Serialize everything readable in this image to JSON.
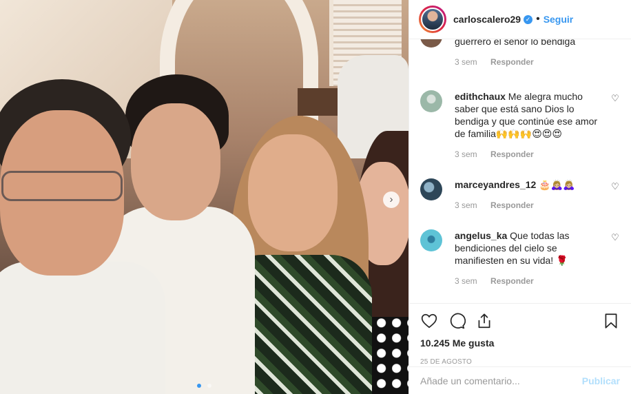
{
  "post": {
    "username": "carloscalero29",
    "separator": "•",
    "follow_label": "Seguir",
    "verified_icon": "verified-badge-icon"
  },
  "comments": [
    {
      "username": "",
      "text": "guerrero el señor lo bendiga",
      "age": "3 sem",
      "reply_label": "Responder",
      "avatar_color": "#7a5a48"
    },
    {
      "username": "edithchaux",
      "text": "Me alegra mucho saber que está sano Dios lo bendiga y que continúe ese amor de familia🙌🙌🙌😍😍😍",
      "age": "3 sem",
      "reply_label": "Responder",
      "avatar_color": "#9bb8a8"
    },
    {
      "username": "marceyandres_12",
      "text": "🎂🙇🏼‍♀️🙇🏼‍♀️",
      "age": "3 sem",
      "reply_label": "Responder",
      "avatar_color": "#2d4658"
    },
    {
      "username": "angelus_ka",
      "text": "Que todas las bendiciones del cielo se manifiesten en su vida! 🌹",
      "age": "3 sem",
      "reply_label": "Responder",
      "avatar_color": "#5ec3d6"
    }
  ],
  "actions": {
    "like_icon": "heart-icon",
    "comment_icon": "comment-icon",
    "share_icon": "share-icon",
    "save_icon": "bookmark-icon"
  },
  "likes_text": "10.245 Me gusta",
  "date_text": "25 DE AGOSTO",
  "add_comment": {
    "placeholder": "Añade un comentario...",
    "publish_label": "Publicar"
  },
  "colors": {
    "accent": "#3897f0",
    "publish_disabled": "#b2dffc",
    "muted": "#999999"
  }
}
